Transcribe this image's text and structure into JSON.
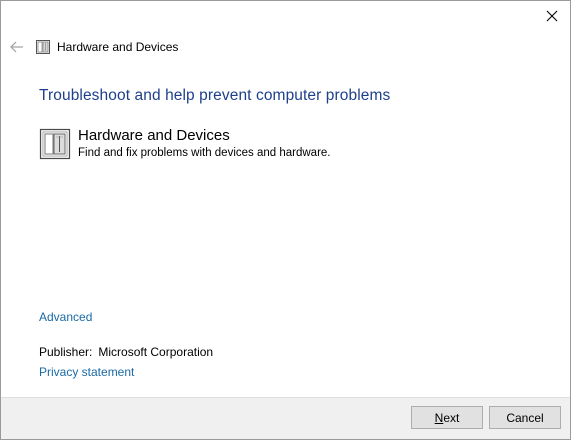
{
  "window": {
    "title": "Hardware and Devices",
    "close_icon": "close-icon",
    "back_icon": "back-arrow-icon",
    "title_icon": "hardware-device-icon"
  },
  "main": {
    "heading": "Troubleshoot and help prevent computer problems",
    "troubleshooter": {
      "name": "Hardware and Devices",
      "description": "Find and fix problems with devices and hardware.",
      "icon": "hardware-device-icon"
    },
    "advanced_link": "Advanced",
    "publisher_label": "Publisher:",
    "publisher_value": "Microsoft Corporation",
    "privacy_link": "Privacy statement"
  },
  "footer": {
    "next_label_underlined": "N",
    "next_label_rest": "ext",
    "cancel_label": "Cancel"
  },
  "colors": {
    "heading": "#1e3f8a",
    "link": "#1a6aa5",
    "footer_bg": "#f0f0f0",
    "button_bg": "#e1e1e1"
  }
}
